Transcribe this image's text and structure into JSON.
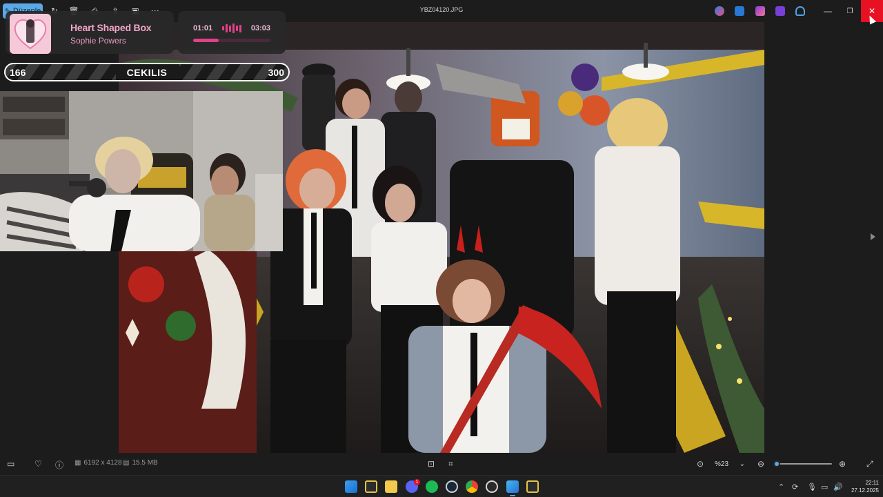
{
  "window": {
    "title": "YBZ04120.JPG",
    "edit_label": "Düzenle",
    "toolbar_icons": [
      "rotate-icon",
      "delete-icon",
      "print-icon",
      "share-icon",
      "slideshow-icon",
      "more-icon"
    ],
    "controls": [
      "minimize-icon",
      "restore-icon",
      "close-icon"
    ]
  },
  "now_playing": {
    "title": "Heart Shaped Box",
    "artist": "Sophie Powers",
    "current_time": "01:01",
    "duration": "03:03",
    "progress": 0.33,
    "accent": "#e1408a"
  },
  "giveaway": {
    "left_count": "166",
    "label": "CEKILIS",
    "right_count": "300"
  },
  "image_info": {
    "dimensions": "6192 x 4128",
    "file_size": "15.5 MB",
    "zoom_level": "%23",
    "zoom_fraction": 0.05
  },
  "taskbar": {
    "apps": [
      "windows-start-icon",
      "file-icon",
      "folder-icon",
      "discord-icon",
      "spotify-icon",
      "steam-icon",
      "chrome-icon",
      "obs-icon",
      "photos-icon",
      "file2-icon"
    ],
    "discord_badge": "1",
    "time": "22:11",
    "date": "27.12.2025"
  },
  "colors": {
    "accent": "#5aa9e6",
    "close": "#e81123",
    "pink": "#f2a6c8"
  }
}
